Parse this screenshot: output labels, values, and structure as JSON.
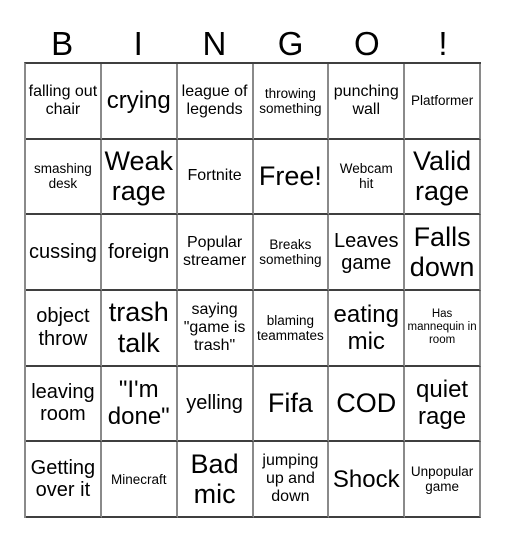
{
  "card": {
    "title_letters": [
      "B",
      "I",
      "N",
      "G",
      "O",
      "!"
    ],
    "columns": 6,
    "rows": 6,
    "colors": {
      "background": "#ffffff",
      "text": "#000000",
      "border_horizontal": "#3f3f3f",
      "border_vertical": "#8a8a8a"
    },
    "cells": [
      {
        "text": "falling out chair",
        "size": "m"
      },
      {
        "text": "crying",
        "size": "xl"
      },
      {
        "text": "league of legends",
        "size": "m"
      },
      {
        "text": "throwing something",
        "size": "s"
      },
      {
        "text": "punching wall",
        "size": "m"
      },
      {
        "text": "Platformer",
        "size": "s"
      },
      {
        "text": "smashing desk",
        "size": "s"
      },
      {
        "text": "Weak rage",
        "size": "xxl"
      },
      {
        "text": "Fortnite",
        "size": "m"
      },
      {
        "text": "Free!",
        "size": "xxl"
      },
      {
        "text": "Webcam hit",
        "size": "s"
      },
      {
        "text": "Valid rage",
        "size": "xxl"
      },
      {
        "text": "cussing",
        "size": "l"
      },
      {
        "text": "foreign",
        "size": "l"
      },
      {
        "text": "Popular streamer",
        "size": "m"
      },
      {
        "text": "Breaks something",
        "size": "s"
      },
      {
        "text": "Leaves game",
        "size": "l"
      },
      {
        "text": "Falls down",
        "size": "xxl"
      },
      {
        "text": "object throw",
        "size": "l"
      },
      {
        "text": "trash talk",
        "size": "xxl"
      },
      {
        "text": "saying \"game is trash\"",
        "size": "m"
      },
      {
        "text": "blaming teammates",
        "size": "s"
      },
      {
        "text": "eating mic",
        "size": "xl"
      },
      {
        "text": "Has mannequin in room",
        "size": "xs"
      },
      {
        "text": "leaving room",
        "size": "l"
      },
      {
        "text": "\"I'm done\"",
        "size": "xl"
      },
      {
        "text": "yelling",
        "size": "l"
      },
      {
        "text": "Fifa",
        "size": "xxl"
      },
      {
        "text": "COD",
        "size": "xxl"
      },
      {
        "text": "quiet rage",
        "size": "xl"
      },
      {
        "text": "Getting over it",
        "size": "l"
      },
      {
        "text": "Minecraft",
        "size": "s"
      },
      {
        "text": "Bad mic",
        "size": "xxl"
      },
      {
        "text": "jumping up and down",
        "size": "m"
      },
      {
        "text": "Shock",
        "size": "xl"
      },
      {
        "text": "Unpopular game",
        "size": "s"
      }
    ]
  }
}
